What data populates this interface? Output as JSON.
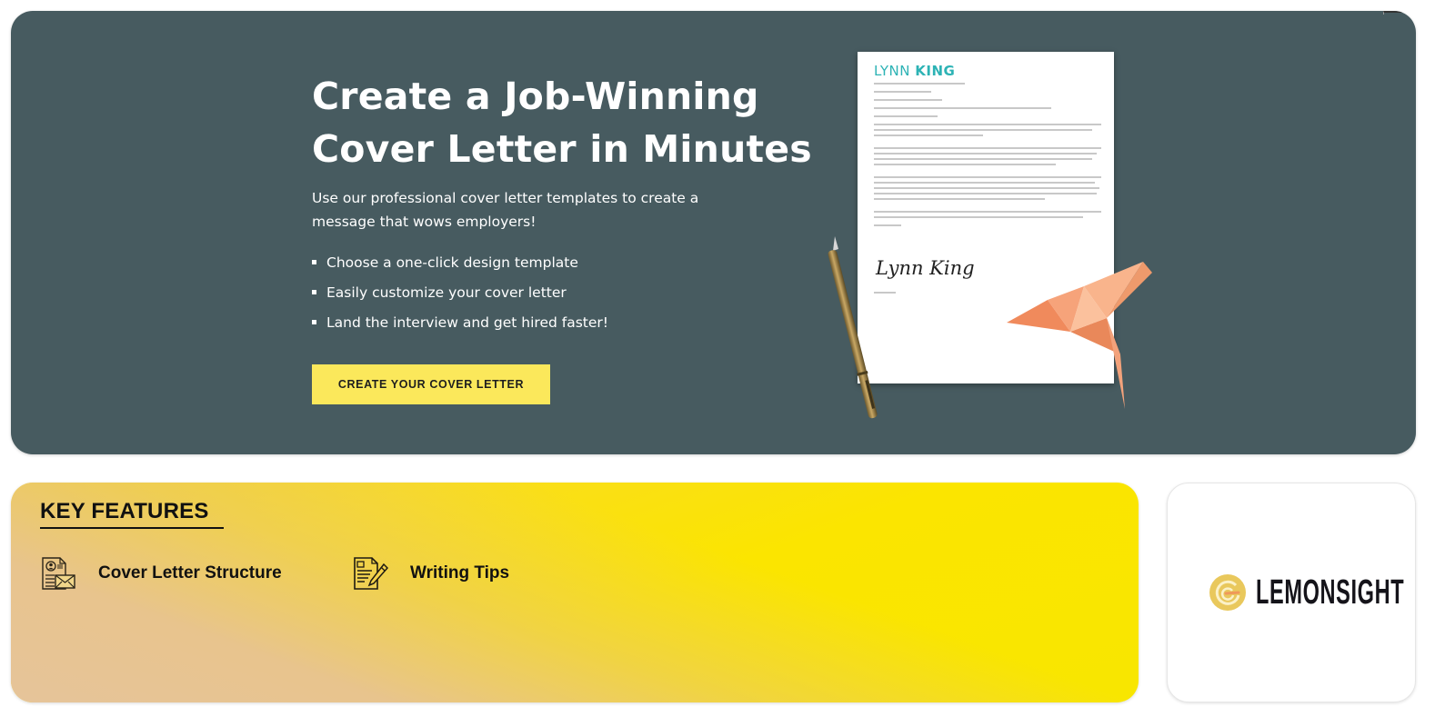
{
  "hero": {
    "title_line1": "Create a Job-Winning",
    "title_line2": "Cover Letter in Minutes",
    "subtitle": "Use our professional cover letter templates to create a message that wows employers!",
    "bullets": [
      "Choose a one-click design template",
      "Easily customize your cover letter",
      "Land the interview and get hired faster!"
    ],
    "cta_label": "CREATE YOUR COVER LETTER",
    "background_color": "#475b60",
    "cta_color": "#fbe85b"
  },
  "letter_preview": {
    "first_name": "LYNN",
    "last_name": "KING",
    "signature": "Lynn King",
    "name_color": "#2db3b5"
  },
  "key_features": {
    "title": "KEY FEATURES",
    "items": [
      {
        "label": "Cover Letter Structure",
        "icon": "cover-letter-document-icon"
      },
      {
        "label": "Writing Tips",
        "icon": "writing-pen-document-icon"
      }
    ]
  },
  "sponsor": {
    "name": "LEMONSIGHT",
    "icon": "lemon-spiral-icon"
  }
}
